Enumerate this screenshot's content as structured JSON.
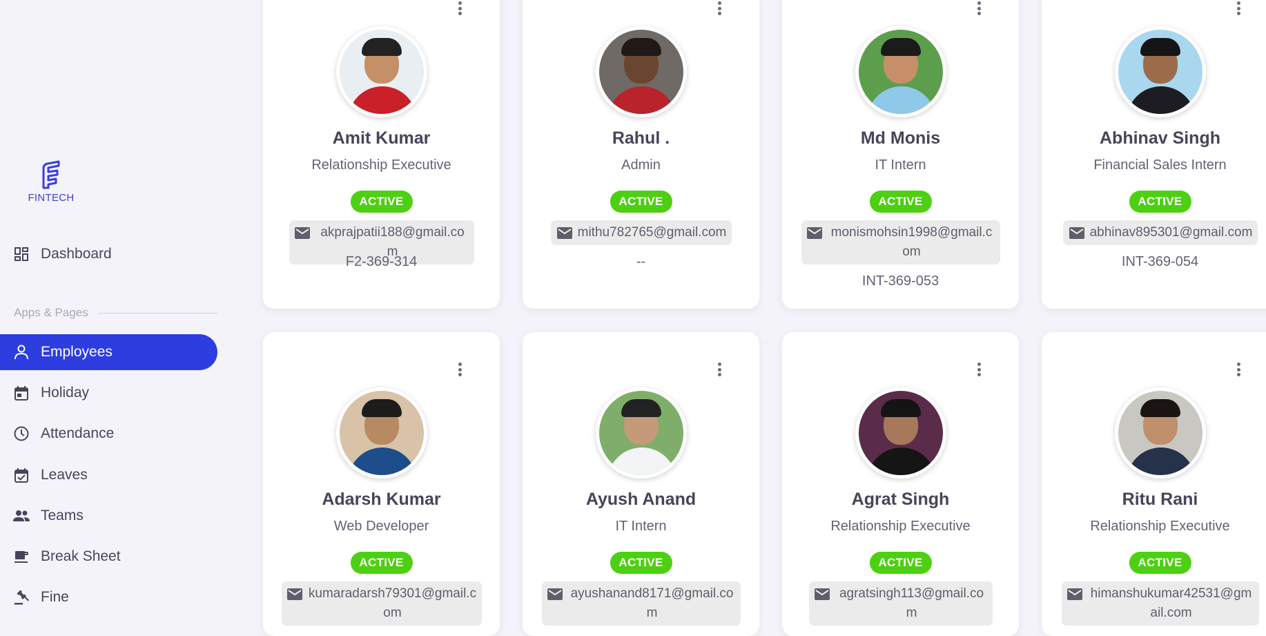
{
  "brand": {
    "logo_text": "FINTECH"
  },
  "sidebar": {
    "section_label": "Apps & Pages",
    "items": [
      {
        "label": "Dashboard",
        "icon": "dashboard-icon",
        "active": false
      },
      {
        "label": "Employees",
        "icon": "person-icon",
        "active": true
      },
      {
        "label": "Holiday",
        "icon": "calendar-icon",
        "active": false
      },
      {
        "label": "Attendance",
        "icon": "clock-icon",
        "active": false
      },
      {
        "label": "Leaves",
        "icon": "calendar-check-icon",
        "active": false
      },
      {
        "label": "Teams",
        "icon": "group-icon",
        "active": false
      },
      {
        "label": "Break Sheet",
        "icon": "coffee-icon",
        "active": false
      },
      {
        "label": "Fine",
        "icon": "gavel-icon",
        "active": false
      }
    ]
  },
  "colors": {
    "accent": "#2d3de0",
    "active_badge": "#4cd011",
    "brand": "#3b3fd8"
  },
  "employees": [
    {
      "name": "Amit Kumar",
      "role": "Relationship Executive",
      "status": "ACTIVE",
      "email": "akprajpatii188@gmail.com",
      "code": "F2-369-314"
    },
    {
      "name": "Rahul .",
      "role": "Admin",
      "status": "ACTIVE",
      "email": "mithu782765@gmail.com",
      "code": "--"
    },
    {
      "name": "Md Monis",
      "role": "IT Intern",
      "status": "ACTIVE",
      "email": "monismohsin1998@gmail.com",
      "code": "INT-369-053"
    },
    {
      "name": "Abhinav Singh",
      "role": "Financial Sales Intern",
      "status": "ACTIVE",
      "email": "abhinav895301@gmail.com",
      "code": "INT-369-054"
    },
    {
      "name": "Adarsh Kumar",
      "role": "Web Developer",
      "status": "ACTIVE",
      "email": "kumaradarsh79301@gmail.com",
      "code": ""
    },
    {
      "name": "Ayush Anand",
      "role": "IT Intern",
      "status": "ACTIVE",
      "email": "ayushanand8171@gmail.com",
      "code": ""
    },
    {
      "name": "Agrat Singh",
      "role": "Relationship Executive",
      "status": "ACTIVE",
      "email": "agratsingh113@gmail.com",
      "code": ""
    },
    {
      "name": "Ritu Rani",
      "role": "Relationship Executive",
      "status": "ACTIVE",
      "email": "himanshukumar42531@gmail.com",
      "code": ""
    }
  ]
}
